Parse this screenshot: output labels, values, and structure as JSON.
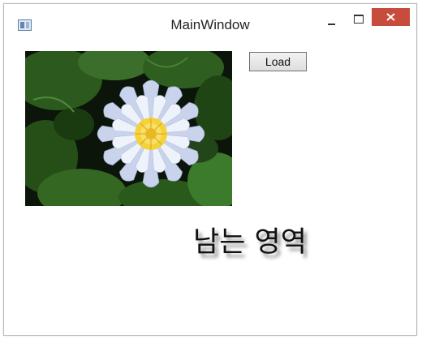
{
  "window": {
    "title": "MainWindow"
  },
  "titlebar_buttons": {
    "minimize_icon": "minimize-icon",
    "maximize_icon": "maximize-icon",
    "close_icon": "close-icon",
    "close_color": "#c74c3c"
  },
  "content": {
    "image": "water-lily-photo",
    "load_button_label": "Load",
    "remaining_area_text": "남는 영역"
  }
}
